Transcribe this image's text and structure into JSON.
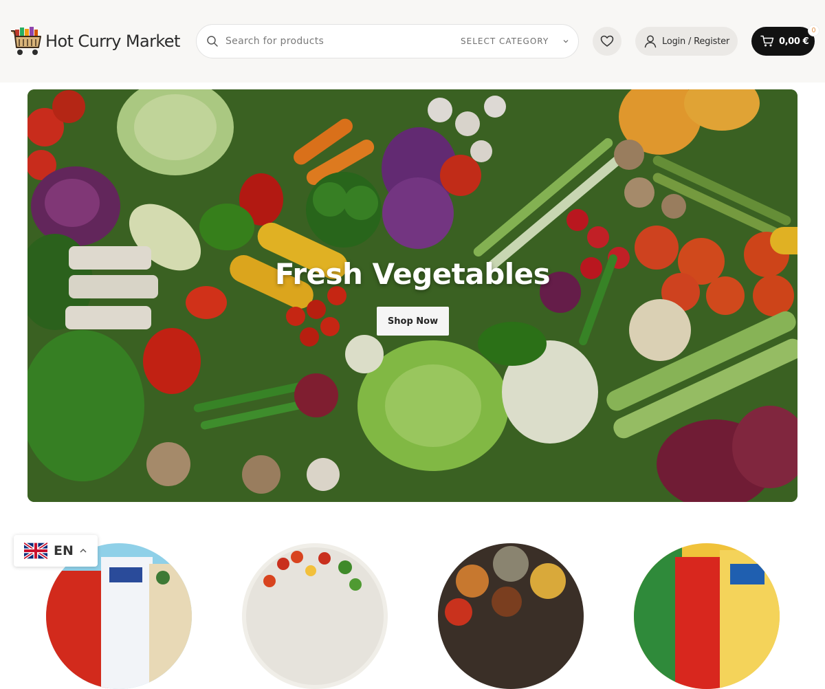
{
  "header": {
    "logo_text": "Hot Curry Market",
    "search": {
      "placeholder": "Search for products",
      "category_label": "SELECT CATEGORY"
    },
    "login_label": "Login / Register",
    "cart": {
      "total": "0,00 €",
      "count": "0"
    }
  },
  "hero": {
    "title": "Fresh Vegetables",
    "button_label": "Shop Now"
  },
  "categories": [
    {
      "icon": "rice-bags-image"
    },
    {
      "icon": "fresh-salad-image"
    },
    {
      "icon": "spices-plate-image"
    },
    {
      "icon": "snacks-packets-image"
    }
  ],
  "language": {
    "code": "EN",
    "flag": "uk-flag-icon"
  },
  "colors": {
    "header_bg": "#f8f7f5",
    "cart_bg": "#121212",
    "accent": "#e08a3a"
  }
}
